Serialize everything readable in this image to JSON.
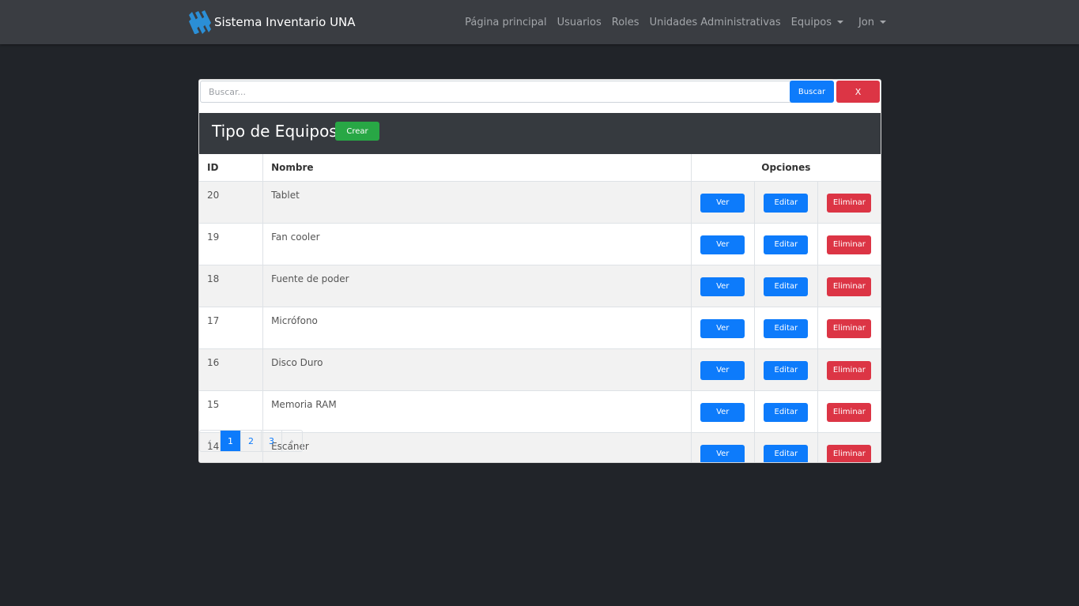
{
  "navbar": {
    "brand": "Sistema Inventario UNA",
    "links": [
      "Página principal",
      "Usuarios",
      "Roles",
      "Unidades Administrativas",
      "Equipos"
    ],
    "user": "Jon"
  },
  "search": {
    "placeholder": "Buscar...",
    "value": "",
    "button": "Buscar",
    "clear": "X"
  },
  "panel": {
    "title": "Tipo de Equipos",
    "create": "Crear"
  },
  "table": {
    "headers": {
      "id": "ID",
      "name": "Nombre",
      "options": "Opciones"
    },
    "actions": {
      "view": "Ver",
      "edit": "Editar",
      "delete": "Eliminar"
    },
    "rows": [
      {
        "id": "20",
        "name": "Tablet"
      },
      {
        "id": "19",
        "name": "Fan cooler"
      },
      {
        "id": "18",
        "name": "Fuente de poder"
      },
      {
        "id": "17",
        "name": "Micrófono"
      },
      {
        "id": "16",
        "name": "Disco Duro"
      },
      {
        "id": "15",
        "name": "Memoria RAM"
      },
      {
        "id": "14",
        "name": "Escáner"
      }
    ]
  },
  "pagination": {
    "prev": "‹",
    "pages": [
      "1",
      "2",
      "3"
    ],
    "current": "1",
    "next": "›"
  },
  "colors": {
    "primary": "#0d7bfb",
    "danger": "#dc3545",
    "success": "#28a745",
    "navbar": "#3a3d42",
    "background": "#212429"
  }
}
